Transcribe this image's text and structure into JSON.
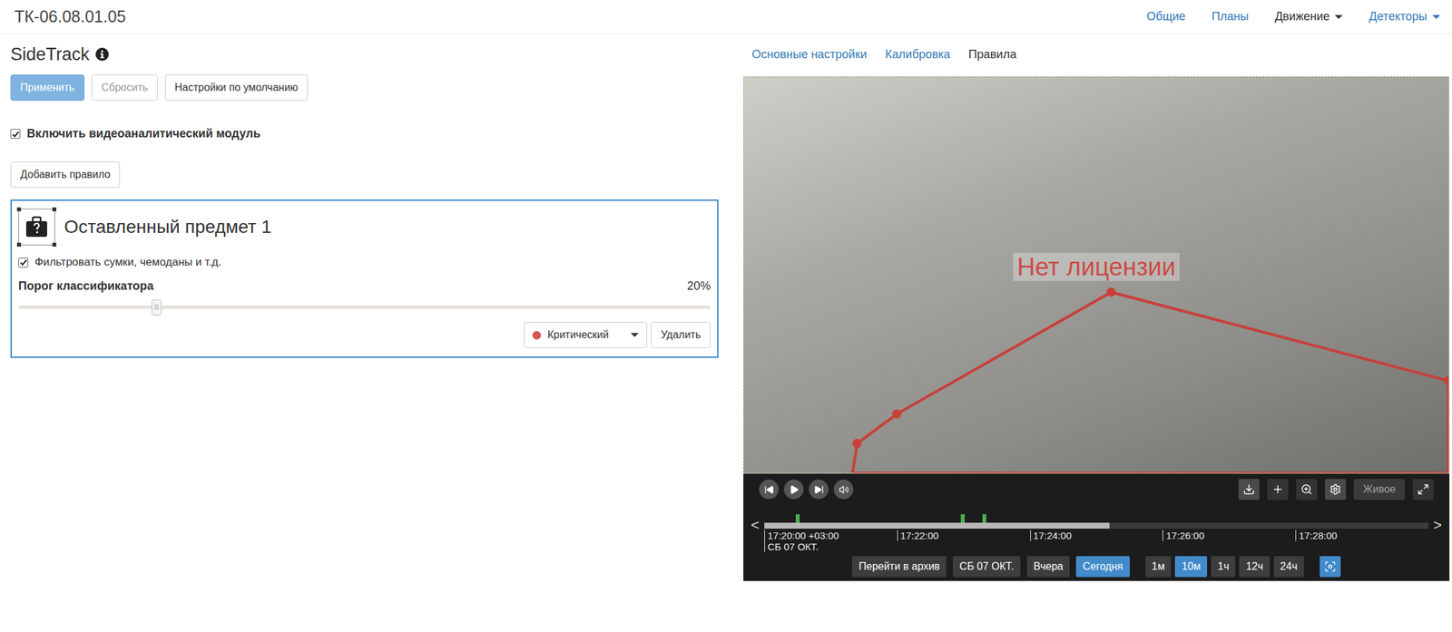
{
  "header": {
    "title": "ТК-06.08.01.05",
    "nav": [
      {
        "label": "Общие",
        "selected": false,
        "dropdown": false
      },
      {
        "label": "Планы",
        "selected": false,
        "dropdown": false
      },
      {
        "label": "Движение",
        "selected": true,
        "dropdown": true
      },
      {
        "label": "Детекторы",
        "selected": false,
        "dropdown": true
      }
    ]
  },
  "panel": {
    "title": "SideTrack",
    "buttons": [
      {
        "label": "Применить",
        "kind": "primary",
        "disabled": true
      },
      {
        "label": "Сбросить",
        "kind": "default",
        "disabled": true
      },
      {
        "label": "Настройки по умолчанию",
        "kind": "default",
        "disabled": false
      }
    ],
    "enable": {
      "label": "Включить видеоаналитический модуль",
      "checked": true
    },
    "add_rule": "Добавить правило"
  },
  "rules": [
    {
      "title": "Оставленный предмет 1",
      "filter": {
        "label": "Фильтровать сумки, чемоданы и т.д.",
        "checked": true
      },
      "threshold": {
        "label": "Порог классификатора",
        "reading": "20%",
        "level": 0.2
      },
      "severity": {
        "label": "Критический",
        "color": "#d9534f"
      },
      "delete": "Удалить"
    }
  ],
  "tabs": [
    {
      "label": "Основные настройки",
      "selected": false
    },
    {
      "label": "Калибровка",
      "selected": false
    },
    {
      "label": "Правила",
      "selected": true
    }
  ],
  "video": {
    "overlay": "Нет лицензии"
  },
  "player": {
    "live": "Живое",
    "timeline": {
      "prev": "<",
      "next": ">",
      "recorded_level": 0.52,
      "events": [
        0.047,
        0.296,
        0.328
      ],
      "ticks": [
        "17:20:00 +03:00",
        "17:22:00",
        "17:24:00",
        "17:26:00",
        "17:28:00"
      ],
      "date": "СБ 07 ОКТ."
    },
    "archive": "Перейти в архив",
    "days": [
      {
        "label": "СБ 07 ОКТ.",
        "selected": false
      },
      {
        "label": "Вчера",
        "selected": false
      },
      {
        "label": "Сегодня",
        "selected": true
      }
    ],
    "ranges": [
      {
        "label": "1м",
        "selected": false
      },
      {
        "label": "10м",
        "selected": true
      },
      {
        "label": "1ч",
        "selected": false
      },
      {
        "label": "12ч",
        "selected": false
      },
      {
        "label": "24ч",
        "selected": false
      }
    ]
  }
}
